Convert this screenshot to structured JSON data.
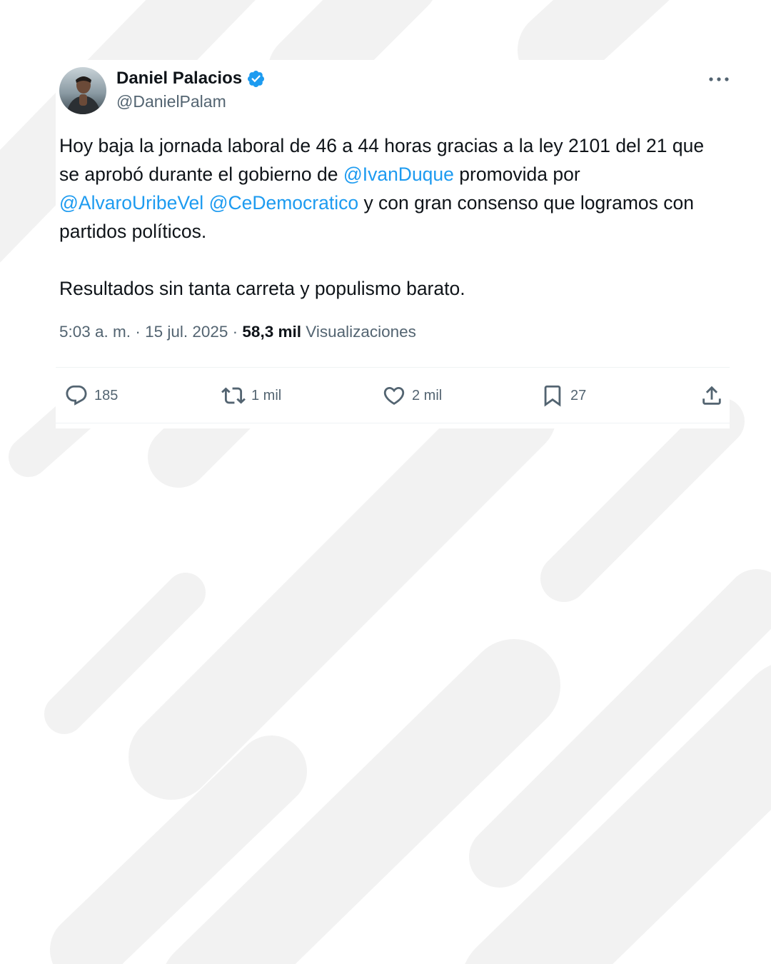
{
  "tweet": {
    "author": {
      "name": "Daniel Palacios",
      "handle": "@DanielPalam",
      "verified_icon": "verified-badge-icon"
    },
    "body": [
      [
        {
          "t": "Hoy baja la jornada laboral de 46 a 44 horas gracias a la ley 2101 del 21 que se aprobó durante el gobierno de "
        },
        {
          "t": "@IvanDuque",
          "mention": true
        },
        {
          "t": " promovida por "
        },
        {
          "t": "@AlvaroUribeVel",
          "mention": true
        },
        {
          "t": " "
        },
        {
          "t": "@CeDemocratico",
          "mention": true
        },
        {
          "t": " y con gran consenso que logramos con partidos políticos."
        }
      ],
      [
        {
          "t": "Resultados sin tanta carreta y populismo barato."
        }
      ]
    ],
    "meta": {
      "time": "5:03 a. m.",
      "sep1": " · ",
      "date": "15 jul. 2025",
      "sep2": " · ",
      "views": "58,3 mil",
      "views_label": "Visualizaciones"
    },
    "actions": {
      "replies": {
        "icon": "reply-icon",
        "count": "185"
      },
      "reposts": {
        "icon": "repost-icon",
        "count": "1 mil"
      },
      "likes": {
        "icon": "heart-icon",
        "count": "2 mil"
      },
      "bookmarks": {
        "icon": "bookmark-icon",
        "count": "27"
      },
      "share": {
        "icon": "share-icon"
      }
    },
    "menu_icon": "more-options-icon"
  },
  "colors": {
    "text": "#0f1419",
    "secondary": "#536471",
    "link": "#1d9bf0",
    "verified": "#1d9bf0",
    "background_stripes": "#f3f3f3"
  }
}
